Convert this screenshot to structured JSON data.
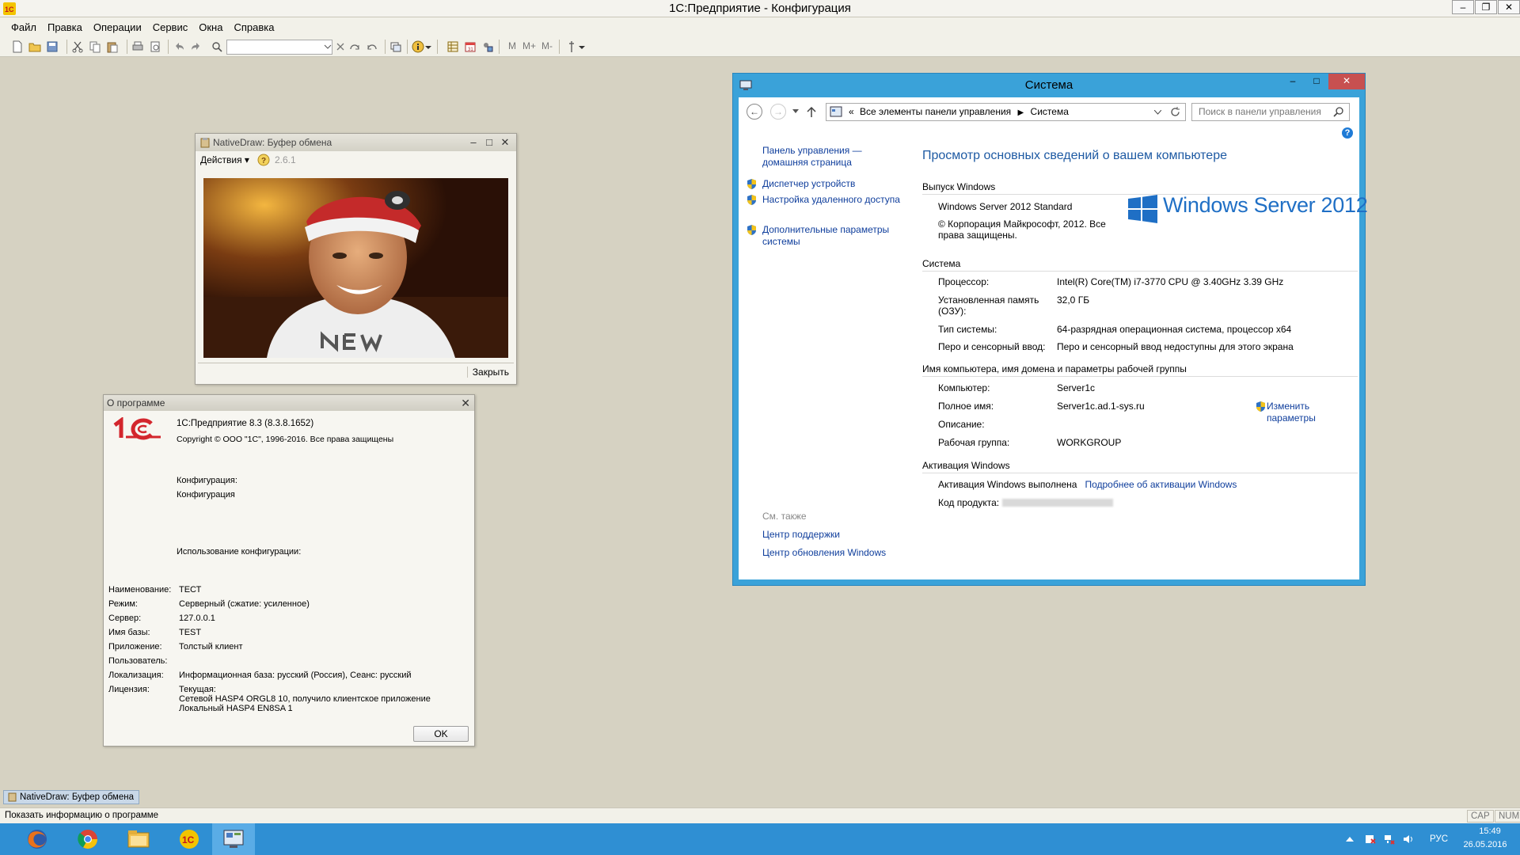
{
  "app": {
    "title": "1С:Предприятие - Конфигурация",
    "menu": [
      "Файл",
      "Правка",
      "Операции",
      "Сервис",
      "Окна",
      "Справка"
    ],
    "toolbar_letters": [
      "M",
      "M+",
      "M-"
    ]
  },
  "nativedraw": {
    "title": "NativeDraw: Буфер обмена",
    "actions_label": "Действия ▾",
    "version": "2.6.1",
    "close_label": "Закрыть"
  },
  "about": {
    "title": "О программе",
    "product": "1С:Предприятие 8.3 (8.3.8.1652)",
    "copyright": "Copyright © ООО \"1С\", 1996-2016. Все права защищены",
    "config_label": "Конфигурация:",
    "config_value": "Конфигурация",
    "usage_label": "Использование конфигурации:",
    "rows": [
      {
        "k": "Наименование:",
        "v": "ТЕСТ"
      },
      {
        "k": "Режим:",
        "v": "Серверный (сжатие: усиленное)"
      },
      {
        "k": "Сервер:",
        "v": "127.0.0.1"
      },
      {
        "k": "Имя базы:",
        "v": "TEST"
      },
      {
        "k": "Приложение:",
        "v": "Толстый клиент"
      },
      {
        "k": "Пользователь:",
        "v": ""
      },
      {
        "k": "Локализация:",
        "v": "Информационная база: русский (Россия), Сеанс: русский"
      }
    ],
    "license_label": "Лицензия:",
    "license_lines": [
      "Текущая:",
      "Сетевой HASP4 ORGL8 10, получило клиентское приложение",
      "Локальный HASP4 EN8SA 1"
    ],
    "ok_label": "OK"
  },
  "system": {
    "title": "Система",
    "address": [
      "Все элементы панели управления",
      "Система"
    ],
    "address_prefix": "«",
    "search_placeholder": "Поиск в панели управления",
    "left": {
      "home": "Панель управления — домашняя страница",
      "links": [
        "Диспетчер устройств",
        "Настройка удаленного доступа",
        "Дополнительные параметры системы"
      ],
      "see_also": "См. также",
      "bottom_links": [
        "Центр поддержки",
        "Центр обновления Windows"
      ]
    },
    "heading": "Просмотр основных сведений о вашем компьютере",
    "edition_section": "Выпуск Windows",
    "edition": "Windows Server 2012 Standard",
    "edition_copy": "© Корпорация Майкрософт, 2012. Все права защищены.",
    "logo_text": "Windows Server 2012",
    "system_section": "Система",
    "system_rows": [
      {
        "k": "Процессор:",
        "v": "Intel(R) Core(TM) i7-3770 CPU @ 3.40GHz   3.39 GHz"
      },
      {
        "k": "Установленная память (ОЗУ):",
        "v": "32,0 ГБ"
      },
      {
        "k": "Тип системы:",
        "v": "64-разрядная операционная система, процессор x64"
      },
      {
        "k": "Перо и сенсорный ввод:",
        "v": "Перо и сенсорный ввод недоступны для этого экрана"
      }
    ],
    "computer_section": "Имя компьютера, имя домена и параметры рабочей группы",
    "computer_rows": [
      {
        "k": "Компьютер:",
        "v": "Server1c"
      },
      {
        "k": "Полное имя:",
        "v": "Server1c.ad.1-sys.ru"
      },
      {
        "k": "Описание:",
        "v": ""
      },
      {
        "k": "Рабочая группа:",
        "v": "WORKGROUP"
      }
    ],
    "change_params": "Изменить параметры",
    "activation_section": "Активация Windows",
    "activation_status": "Активация Windows выполнена",
    "activation_link": "Подробнее об активации Windows",
    "product_key_label": "Код продукта:"
  },
  "taskwindow": {
    "label": "NativeDraw: Буфер обмена"
  },
  "status": {
    "text": "Показать информацию о программе",
    "cap": "CAP",
    "num": "NUM"
  },
  "taskbar": {
    "apps": [
      "firefox-icon",
      "chrome-icon",
      "explorer-icon",
      "1c-icon",
      "control-panel-icon"
    ],
    "lang": "РУС",
    "time": "15:49",
    "date": "26.05.2016"
  },
  "colors": {
    "accent": "#3aa2d9",
    "link": "#0f3e9c",
    "heading": "#1e5aa3",
    "taskbar": "#2f8fd3",
    "logo_red": "#d3262d"
  }
}
